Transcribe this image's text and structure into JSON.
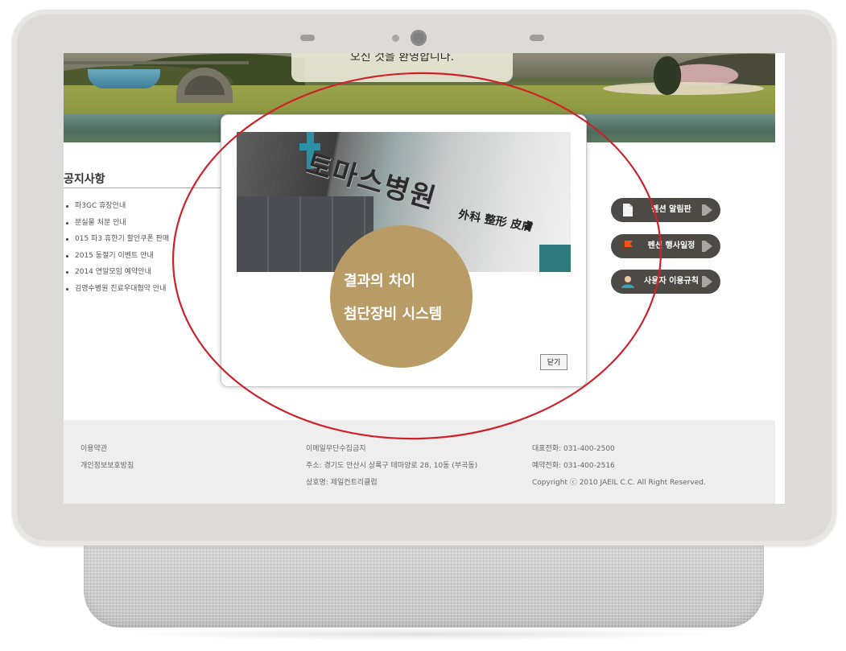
{
  "banner": {
    "welcome_text": "오신 것을 환영합니다."
  },
  "notice": {
    "title": "공지사항",
    "items": [
      "파3GC 휴장안내",
      "분실물 처분 안내",
      "015 파3 휴한기 할인쿠폰 판매",
      "2015 동절기 이벤트 안내",
      "2014 연말모임 예약안내",
      "김영수병원 진료우대협약 안내"
    ]
  },
  "popup": {
    "sign_text": "토마스병원",
    "sub_text": "外科 整形 皮膚",
    "circle_line1": "결과의 차이",
    "circle_line2": "첨단장비 시스템",
    "close_label": "닫기"
  },
  "quick_links": [
    {
      "label": "펜션 알림판",
      "icon": "document-icon"
    },
    {
      "label": "펜션 행사일정",
      "icon": "flag-icon"
    },
    {
      "label": "사용자 이용규칙",
      "icon": "user-icon"
    }
  ],
  "footer": {
    "col1": [
      "이용약관",
      "개인정보보호방침"
    ],
    "col2": [
      "이메일무단수집금지",
      "주소: 경기도 안산시 상록구 테마양로 28, 10동 (부곡동)",
      "상호명: 제일컨트리클럽"
    ],
    "col3": [
      "대표전화: 031-400-2500",
      "예약전화: 031-400-2516",
      "Copyright ⓒ 2010 JAEIL C.C. All Right Reserved."
    ]
  },
  "colors": {
    "accent_circle": "#b99b65",
    "quick_button_bg": "#4d4a46",
    "annotation_ellipse": "#d0202a",
    "footer_bg": "#eeeeee"
  }
}
